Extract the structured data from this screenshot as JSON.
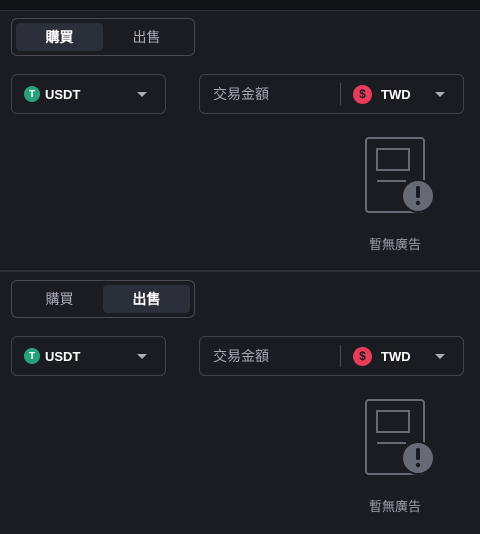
{
  "panels": [
    {
      "tabs": {
        "buy": "購買",
        "sell": "出售",
        "active": "buy"
      },
      "coin": {
        "name": "USDT",
        "icon": "tether-icon",
        "icon_glyph": "T",
        "icon_color": "#26a17b"
      },
      "amount": {
        "placeholder": "交易金額",
        "value": ""
      },
      "fiat": {
        "name": "TWD",
        "icon": "dollar-icon",
        "icon_glyph": "$",
        "icon_color": "#e83c5a"
      },
      "empty_state": {
        "icon": "no-ads-icon",
        "text": "暫無廣告"
      }
    },
    {
      "tabs": {
        "buy": "購買",
        "sell": "出售",
        "active": "sell"
      },
      "coin": {
        "name": "USDT",
        "icon": "tether-icon",
        "icon_glyph": "T",
        "icon_color": "#26a17b"
      },
      "amount": {
        "placeholder": "交易金額",
        "value": ""
      },
      "fiat": {
        "name": "TWD",
        "icon": "dollar-icon",
        "icon_glyph": "$",
        "icon_color": "#e83c5a"
      },
      "empty_state": {
        "icon": "no-ads-icon",
        "text": "暫無廣告"
      }
    }
  ],
  "colors": {
    "background": "#1b1c21",
    "active_tab_bg": "#2b2f3a",
    "border": "#3f424b",
    "muted_text": "#9a9ea8"
  }
}
